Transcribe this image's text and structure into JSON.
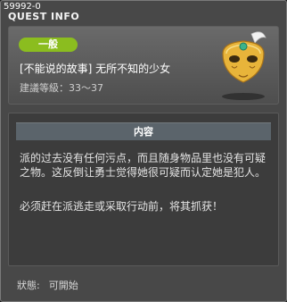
{
  "window": {
    "id": "59992-0",
    "title": "QUEST INFO"
  },
  "quest": {
    "category": "一般",
    "title": "[不能说的故事] 无所不知的少女",
    "recommended_level": "建議等級：33～37"
  },
  "content": {
    "header": "内容",
    "paragraph1": "派的过去没有任何污点，而且随身物品里也没有可疑之物。这反倒让勇士觉得她很可疑而认定她是犯人。",
    "paragraph2": "必须赶在派逃走或采取行动前，将其抓获！"
  },
  "status": {
    "label": "狀態:",
    "value": "可開始"
  },
  "colors": {
    "badge": "#8bbd1f",
    "panel_bg": "#484848",
    "mask_gold": "#e8b43a",
    "jewel": "#3bb38a"
  },
  "icons": {
    "title_icon": "star-icon",
    "quest_icon": "golden-mask-icon"
  }
}
